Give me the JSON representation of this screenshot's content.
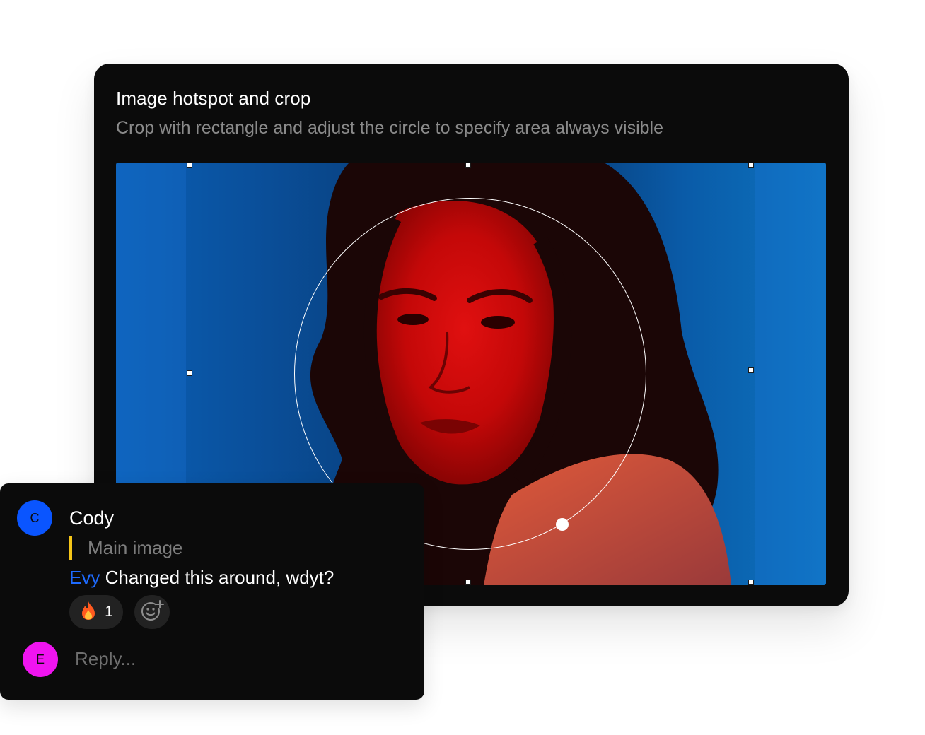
{
  "editor": {
    "title": "Image hotspot and crop",
    "subtitle": "Crop with rectangle and adjust the circle to specify area always visible"
  },
  "comment": {
    "avatar_initial": "C",
    "author": "Cody",
    "quote": "Main image",
    "mention": "Evy",
    "message": "Changed this around, wdyt?",
    "reaction": {
      "emoji": "🔥",
      "count": "1"
    },
    "add_reaction_icon": "add-emoji-icon"
  },
  "reply": {
    "avatar_initial": "E",
    "placeholder": "Reply..."
  },
  "colors": {
    "card_bg": "#0b0b0b",
    "avatar_cody": "#0a55ff",
    "avatar_evy": "#f014f0",
    "mention": "#1e6bff",
    "quote_bar": "#f5c518"
  }
}
